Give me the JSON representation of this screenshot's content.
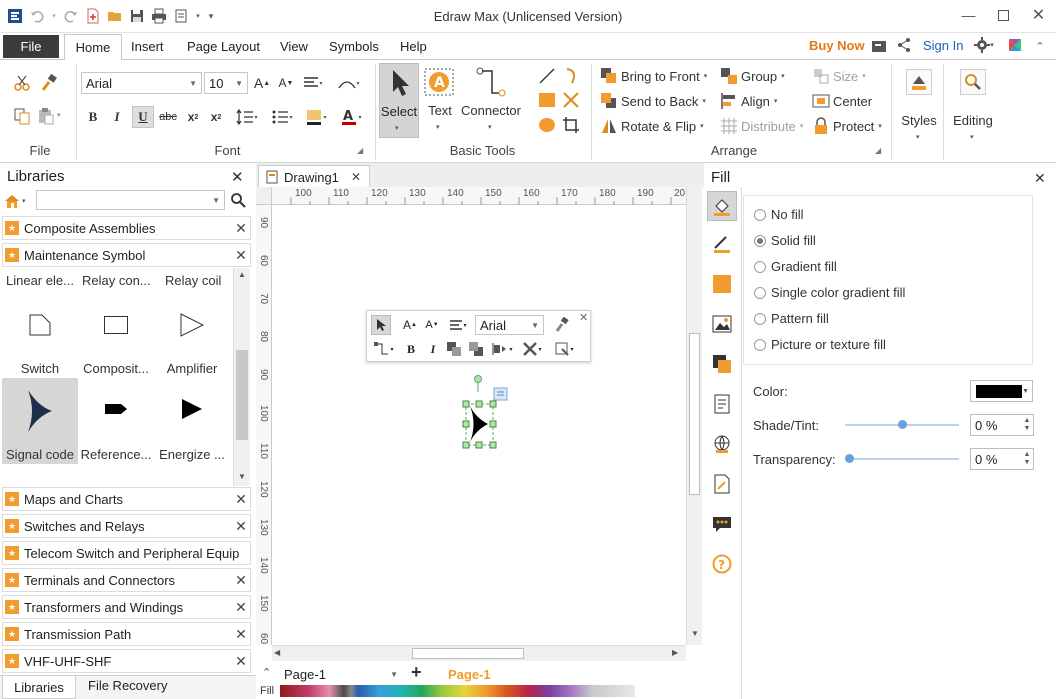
{
  "window": {
    "title": "Edraw Max (Unlicensed Version)",
    "minimize_icon": "minimize-icon",
    "maximize_icon": "maximize-icon",
    "close_icon": "close-icon"
  },
  "menu": {
    "file": "File",
    "items": [
      "Home",
      "Insert",
      "Page Layout",
      "View",
      "Symbols",
      "Help"
    ],
    "buy_now": "Buy Now",
    "sign_in": "Sign In"
  },
  "ribbon": {
    "groups": {
      "file": "File",
      "font": "Font",
      "basic_tools": "Basic Tools",
      "arrange": "Arrange"
    },
    "font_name": "Arial",
    "font_size": "10",
    "select_label": "Select",
    "text_label": "Text",
    "connector_label": "Connector",
    "arrange": {
      "bring_to_front": "Bring to Front",
      "send_to_back": "Send to Back",
      "rotate_flip": "Rotate & Flip",
      "group": "Group",
      "align": "Align",
      "distribute": "Distribute",
      "size": "Size",
      "center": "Center",
      "protect": "Protect"
    },
    "styles_label": "Styles",
    "editing_label": "Editing"
  },
  "libraries": {
    "title": "Libraries",
    "search_placeholder": "",
    "open": [
      {
        "label": "Composite Assemblies"
      },
      {
        "label": "Maintenance Symbol"
      }
    ],
    "column_labels": [
      "Linear ele...",
      "Relay con...",
      "Relay coil"
    ],
    "shapes": [
      {
        "label": "Switch"
      },
      {
        "label": "Composit..."
      },
      {
        "label": "Amplifier"
      },
      {
        "label": "Signal code",
        "selected": true
      },
      {
        "label": "Reference..."
      },
      {
        "label": "Energize ..."
      }
    ],
    "closed": [
      {
        "label": "Maps and Charts"
      },
      {
        "label": "Switches and Relays"
      },
      {
        "label": "Telecom Switch and Peripheral Equip"
      },
      {
        "label": "Terminals and Connectors"
      },
      {
        "label": "Transformers and Windings"
      },
      {
        "label": "Transmission Path"
      },
      {
        "label": "VHF-UHF-SHF"
      }
    ],
    "bottom_tabs": [
      "Libraries",
      "File Recovery"
    ]
  },
  "document": {
    "tab": "Drawing1",
    "h_ruler": [
      "100",
      "110",
      "120",
      "130",
      "140",
      "150",
      "160",
      "170",
      "180",
      "190",
      "20"
    ],
    "v_ruler": [
      "90",
      "60",
      "70",
      "80",
      "90",
      "100",
      "110",
      "120",
      "130",
      "140",
      "150",
      "60"
    ],
    "page_select": "Page-1",
    "page_tab": "Page-1",
    "fill_label": "Fill",
    "float_font": "Arial"
  },
  "fill_panel": {
    "title": "Fill",
    "options": [
      {
        "label": "No fill",
        "checked": false
      },
      {
        "label": "Solid fill",
        "checked": true
      },
      {
        "label": "Gradient fill",
        "checked": false
      },
      {
        "label": "Single color gradient fill",
        "checked": false
      },
      {
        "label": "Pattern fill",
        "checked": false
      },
      {
        "label": "Picture or texture fill",
        "checked": false
      }
    ],
    "color_label": "Color:",
    "color_value": "#000000",
    "shade_label": "Shade/Tint:",
    "shade_value": "0 %",
    "shade_level": 0.5,
    "transparency_label": "Transparency:",
    "transparency_value": "0 %",
    "transparency_level": 0
  },
  "colors": {
    "accent_orange": "#f29b2f",
    "file_tab": "#3b3b3b",
    "buy_now": "#e07b18",
    "sign_in": "#1a5fb4"
  }
}
